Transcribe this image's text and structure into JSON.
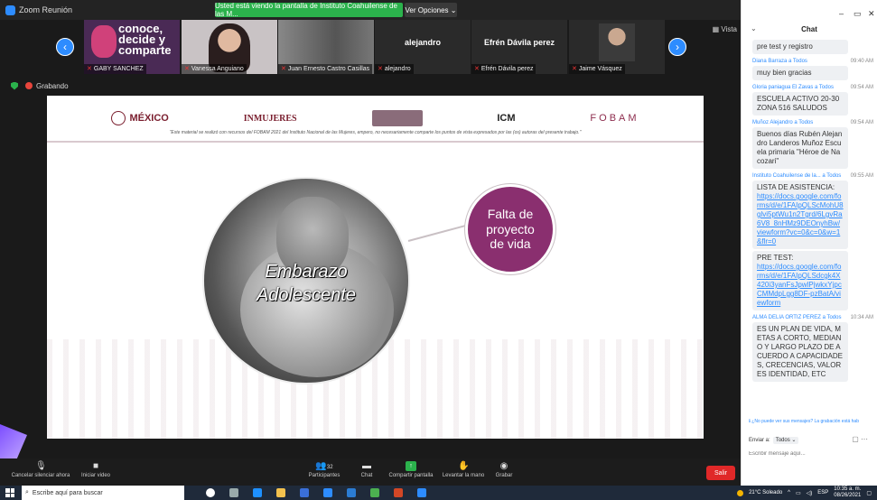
{
  "window": {
    "title": "Zoom Reunión"
  },
  "banner": {
    "sharing": "Usted está viendo la pantalla de Instituto Coahuilense de las M...",
    "view_options": "Ver Opciones"
  },
  "strip": {
    "view_button": "Vista",
    "tiles": [
      {
        "name": "GABY SANCHEZ",
        "label": "conoce, decide y comparte"
      },
      {
        "name": "Vanessa Anguiano",
        "label": ""
      },
      {
        "name": "Juan Ernesto Castro Casillas",
        "label": ""
      },
      {
        "name": "alejandro",
        "label": "alejandro"
      },
      {
        "name": "Efrén Dávila perez",
        "label": "Efrén Dávila perez"
      },
      {
        "name": "Jaime Vásquez",
        "label": ""
      }
    ]
  },
  "recording": {
    "label": "Grabando"
  },
  "slide": {
    "logos": [
      "MÉXICO",
      "INMUJERES",
      "ICM",
      "FOBAM"
    ],
    "disclaimer": "\"Este material se realizó con recursos del FOBAM 2021 del Instituto Nacional de las Mujeres, empero, no necesariamente comparte los puntos de vista expresados por las (os) autoras del presente trabajo.\"",
    "circle_line1": "Embarazo",
    "circle_line2": "Adolescente",
    "purple_text": "Falta de proyecto de vida"
  },
  "toolbar": {
    "mute": "Cancelar silenciar ahora",
    "video": "Iniciar video",
    "participants": "Participantes",
    "participants_count": "32",
    "chat": "Chat",
    "share": "Compartir pantalla",
    "raise_hand": "Levantar la mano",
    "record": "Grabar",
    "leave": "Salir"
  },
  "chat": {
    "title": "Chat",
    "messages": [
      {
        "from": "",
        "time": "",
        "lines": [
          "pre test y registro"
        ]
      },
      {
        "from": "Diana Barraza a Todos",
        "time": "09:40 AM",
        "lines": [
          "muy bien gracias"
        ]
      },
      {
        "from": "Gloria paniagua El Zavas a Todos",
        "time": "09:54 AM",
        "lines": [
          "ESCUELA ACTIVO 20-30 ZONA 516 SALUDOS"
        ]
      },
      {
        "from": "Muñoz Alejandro a Todos",
        "time": "09:54 AM",
        "lines": [
          "Buenos días Rubén Alejandro Landeros Muñoz Escuela primaria \"Héroe de Nacozari\""
        ]
      },
      {
        "from": "Instituto Coahuilense de la... a Todos",
        "time": "09:55 AM",
        "lines": [
          "LISTA DE ASISTENCIA:",
          "PRE TEST:"
        ],
        "links": [
          "https://docs.google.com/forms/d/e/1FAIpQLScMohU8glvi5ptWu1n2Tgrd/6LgvRa6V8_8nHMz9DEOnyhBw/viewform?vc=0&c=0&w=1&flr=0",
          "https://docs.google.com/forms/d/e/1FAIpQLSdcgk4X420i3yanFsJpwlPjwkxYjpcCMMdpLgg8DF-pzBatA/viewform"
        ]
      },
      {
        "from": "ALMA DELIA ORTIZ PEREZ a Todos",
        "time": "10:34 AM",
        "lines": [
          "ES UN PLAN DE VIDA, METAS A CORTO, MEDIANO Y LARGO PLAZO DE ACUERDO A CAPACIDADES, CRECENCIAS, VALORES IDENTIDAD, ETC"
        ]
      }
    ],
    "notice": "¿No puede ver sus mensajes? La grabación está hab",
    "send_to_label": "Enviar a:",
    "send_to_value": "Todos",
    "input_placeholder": "Escribir mensaje aquí..."
  },
  "taskbar": {
    "search_placeholder": "Escribe aquí para buscar",
    "weather": "21°C Soleado",
    "lang": "ESP",
    "time": "10:35 a. m.",
    "date": "08/26/2021"
  }
}
